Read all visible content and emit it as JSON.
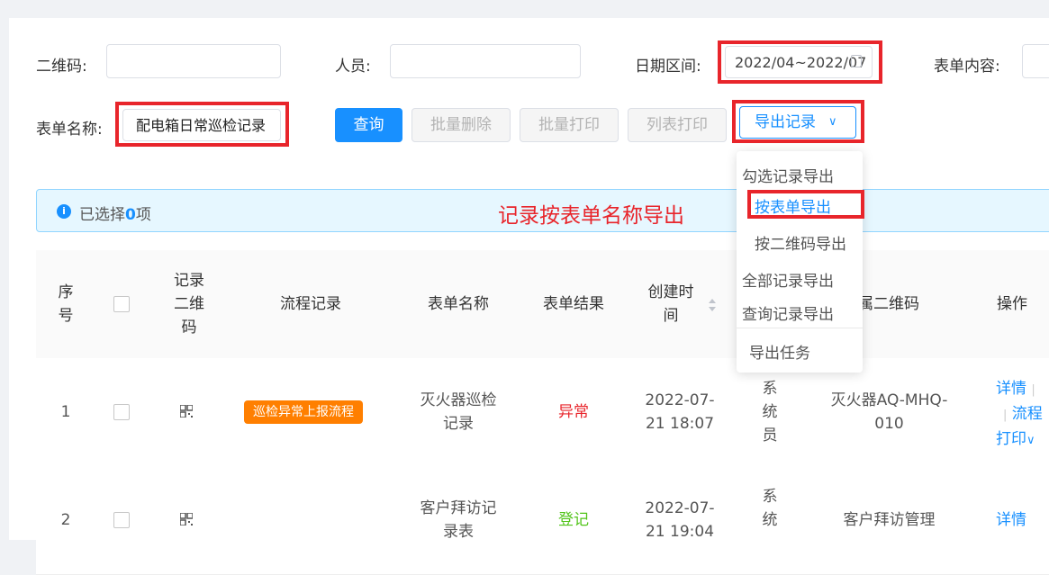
{
  "filters": {
    "qrcode_label": "二维码:",
    "person_label": "人员:",
    "date_range_label": "日期区间:",
    "date_range_value": "2022/04~2022/07",
    "form_content_label": "表单内容:",
    "form_name_label": "表单名称:",
    "form_name_value": "配电箱日常巡检记录"
  },
  "toolbar": {
    "query": "查询",
    "batch_delete": "批量删除",
    "batch_print": "批量打印",
    "list_print": "列表打印",
    "export_records": "导出记录"
  },
  "export_menu": {
    "group_checked": "勾选记录导出",
    "by_form_name": "按表单导出",
    "by_qrcode": "按二维码导出",
    "all_records": "全部记录导出",
    "query_records": "查询记录导出",
    "export_tasks": "导出任务"
  },
  "alert": {
    "prefix": "已选择",
    "count": "0",
    "suffix": "项"
  },
  "annotation": "记录按表单名称导出",
  "table": {
    "headers": {
      "index": [
        "序",
        "号"
      ],
      "record_qr": [
        "记录",
        "二维",
        "码"
      ],
      "flow_record": "流程记录",
      "form_name": "表单名称",
      "form_result": "表单结果",
      "created_time": [
        "创建时",
        "间"
      ],
      "qr_owner": "所属二维码",
      "actions": "操作"
    },
    "rows": [
      {
        "index": "1",
        "flow_tag": "巡检异常上报流程",
        "form_name": [
          "灭火器巡检",
          "记录"
        ],
        "result": "异常",
        "result_color": "#e8252b",
        "created": [
          "2022-07-",
          "21 18:07"
        ],
        "creator": [
          "系",
          "统",
          "员"
        ],
        "qr_name": [
          "灭火器AQ-MHQ-",
          "010"
        ],
        "actions": {
          "detail": "详情",
          "sep1": "|",
          "flow": "流程",
          "print": "打印",
          "caret": "∨"
        }
      },
      {
        "index": "2",
        "form_name": [
          "客户拜访记",
          "录表"
        ],
        "result": "登记",
        "result_color": "#52c41a",
        "created": [
          "2022-07-",
          "21 19:04"
        ],
        "creator": [
          "系",
          "统"
        ],
        "qr_name": [
          "客户拜访管理"
        ],
        "actions": {
          "detail": "详情"
        }
      }
    ]
  },
  "colors": {
    "primary": "#1890ff",
    "highlight_red": "#e8252b",
    "tag_orange": "#ff7f00"
  }
}
